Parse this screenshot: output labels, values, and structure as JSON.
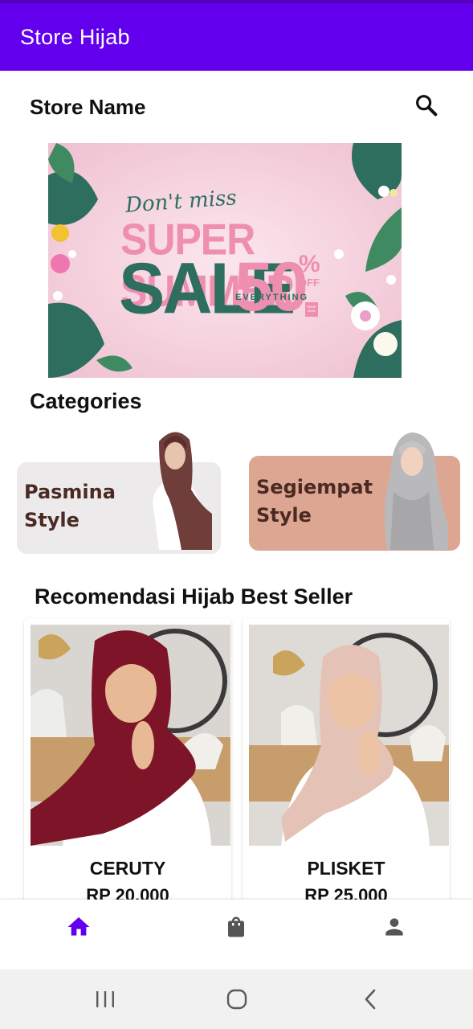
{
  "app_bar": {
    "title": "Store Hijab",
    "color": "#6200ee"
  },
  "store": {
    "name": "Store Name",
    "search_icon": "search-icon"
  },
  "banner": {
    "line1": "Don't miss",
    "line2": "SUPER SUMMER",
    "line3": "SALE",
    "discount": "50",
    "percent": "%",
    "off": "OFF",
    "everything": "EVERYTHING",
    "shop": "SHOP NOW"
  },
  "categories": {
    "title": "Categories",
    "items": [
      {
        "line1": "Pasmina",
        "line2": "Style",
        "color": "#eceaeb"
      },
      {
        "line1": "Segiempat",
        "line2": "Style",
        "color": "#dda692"
      }
    ]
  },
  "recommendations": {
    "title": "Recomendasi Hijab Best Seller",
    "products": [
      {
        "name": "CERUTY",
        "price": "RP 20.000",
        "hijab_color": "#7e1428"
      },
      {
        "name": "PLISKET",
        "price": "RP 25.000",
        "hijab_color": "#e5c2b6"
      }
    ]
  },
  "bottom_nav": {
    "items": [
      {
        "icon": "home-icon",
        "active": true
      },
      {
        "icon": "shopping-bag-icon",
        "active": false
      },
      {
        "icon": "person-icon",
        "active": false
      }
    ],
    "active_color": "#6200ee",
    "inactive_color": "#555555"
  },
  "system_nav": {
    "items": [
      "recent-apps-icon",
      "home-circle-icon",
      "back-icon"
    ]
  }
}
